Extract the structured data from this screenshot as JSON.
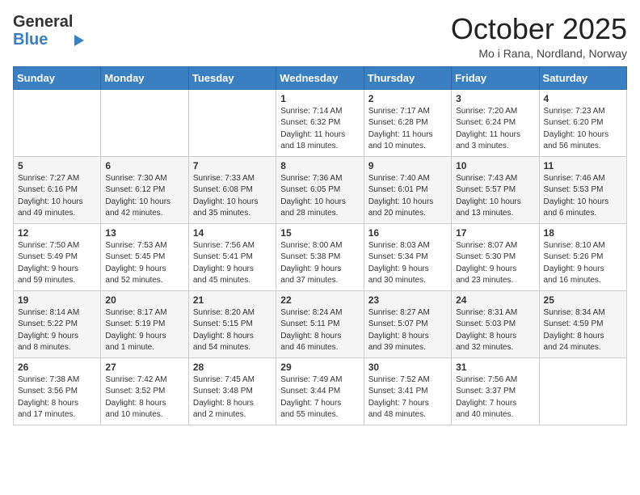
{
  "header": {
    "logo_general": "General",
    "logo_blue": "Blue",
    "month_title": "October 2025",
    "location": "Mo i Rana, Nordland, Norway"
  },
  "calendar": {
    "days_of_week": [
      "Sunday",
      "Monday",
      "Tuesday",
      "Wednesday",
      "Thursday",
      "Friday",
      "Saturday"
    ],
    "weeks": [
      [
        {
          "day": "",
          "info": ""
        },
        {
          "day": "",
          "info": ""
        },
        {
          "day": "",
          "info": ""
        },
        {
          "day": "1",
          "info": "Sunrise: 7:14 AM\nSunset: 6:32 PM\nDaylight: 11 hours\nand 18 minutes."
        },
        {
          "day": "2",
          "info": "Sunrise: 7:17 AM\nSunset: 6:28 PM\nDaylight: 11 hours\nand 10 minutes."
        },
        {
          "day": "3",
          "info": "Sunrise: 7:20 AM\nSunset: 6:24 PM\nDaylight: 11 hours\nand 3 minutes."
        },
        {
          "day": "4",
          "info": "Sunrise: 7:23 AM\nSunset: 6:20 PM\nDaylight: 10 hours\nand 56 minutes."
        }
      ],
      [
        {
          "day": "5",
          "info": "Sunrise: 7:27 AM\nSunset: 6:16 PM\nDaylight: 10 hours\nand 49 minutes."
        },
        {
          "day": "6",
          "info": "Sunrise: 7:30 AM\nSunset: 6:12 PM\nDaylight: 10 hours\nand 42 minutes."
        },
        {
          "day": "7",
          "info": "Sunrise: 7:33 AM\nSunset: 6:08 PM\nDaylight: 10 hours\nand 35 minutes."
        },
        {
          "day": "8",
          "info": "Sunrise: 7:36 AM\nSunset: 6:05 PM\nDaylight: 10 hours\nand 28 minutes."
        },
        {
          "day": "9",
          "info": "Sunrise: 7:40 AM\nSunset: 6:01 PM\nDaylight: 10 hours\nand 20 minutes."
        },
        {
          "day": "10",
          "info": "Sunrise: 7:43 AM\nSunset: 5:57 PM\nDaylight: 10 hours\nand 13 minutes."
        },
        {
          "day": "11",
          "info": "Sunrise: 7:46 AM\nSunset: 5:53 PM\nDaylight: 10 hours\nand 6 minutes."
        }
      ],
      [
        {
          "day": "12",
          "info": "Sunrise: 7:50 AM\nSunset: 5:49 PM\nDaylight: 9 hours\nand 59 minutes."
        },
        {
          "day": "13",
          "info": "Sunrise: 7:53 AM\nSunset: 5:45 PM\nDaylight: 9 hours\nand 52 minutes."
        },
        {
          "day": "14",
          "info": "Sunrise: 7:56 AM\nSunset: 5:41 PM\nDaylight: 9 hours\nand 45 minutes."
        },
        {
          "day": "15",
          "info": "Sunrise: 8:00 AM\nSunset: 5:38 PM\nDaylight: 9 hours\nand 37 minutes."
        },
        {
          "day": "16",
          "info": "Sunrise: 8:03 AM\nSunset: 5:34 PM\nDaylight: 9 hours\nand 30 minutes."
        },
        {
          "day": "17",
          "info": "Sunrise: 8:07 AM\nSunset: 5:30 PM\nDaylight: 9 hours\nand 23 minutes."
        },
        {
          "day": "18",
          "info": "Sunrise: 8:10 AM\nSunset: 5:26 PM\nDaylight: 9 hours\nand 16 minutes."
        }
      ],
      [
        {
          "day": "19",
          "info": "Sunrise: 8:14 AM\nSunset: 5:22 PM\nDaylight: 9 hours\nand 8 minutes."
        },
        {
          "day": "20",
          "info": "Sunrise: 8:17 AM\nSunset: 5:19 PM\nDaylight: 9 hours\nand 1 minute."
        },
        {
          "day": "21",
          "info": "Sunrise: 8:20 AM\nSunset: 5:15 PM\nDaylight: 8 hours\nand 54 minutes."
        },
        {
          "day": "22",
          "info": "Sunrise: 8:24 AM\nSunset: 5:11 PM\nDaylight: 8 hours\nand 46 minutes."
        },
        {
          "day": "23",
          "info": "Sunrise: 8:27 AM\nSunset: 5:07 PM\nDaylight: 8 hours\nand 39 minutes."
        },
        {
          "day": "24",
          "info": "Sunrise: 8:31 AM\nSunset: 5:03 PM\nDaylight: 8 hours\nand 32 minutes."
        },
        {
          "day": "25",
          "info": "Sunrise: 8:34 AM\nSunset: 4:59 PM\nDaylight: 8 hours\nand 24 minutes."
        }
      ],
      [
        {
          "day": "26",
          "info": "Sunrise: 7:38 AM\nSunset: 3:56 PM\nDaylight: 8 hours\nand 17 minutes."
        },
        {
          "day": "27",
          "info": "Sunrise: 7:42 AM\nSunset: 3:52 PM\nDaylight: 8 hours\nand 10 minutes."
        },
        {
          "day": "28",
          "info": "Sunrise: 7:45 AM\nSunset: 3:48 PM\nDaylight: 8 hours\nand 2 minutes."
        },
        {
          "day": "29",
          "info": "Sunrise: 7:49 AM\nSunset: 3:44 PM\nDaylight: 7 hours\nand 55 minutes."
        },
        {
          "day": "30",
          "info": "Sunrise: 7:52 AM\nSunset: 3:41 PM\nDaylight: 7 hours\nand 48 minutes."
        },
        {
          "day": "31",
          "info": "Sunrise: 7:56 AM\nSunset: 3:37 PM\nDaylight: 7 hours\nand 40 minutes."
        },
        {
          "day": "",
          "info": ""
        }
      ]
    ]
  }
}
